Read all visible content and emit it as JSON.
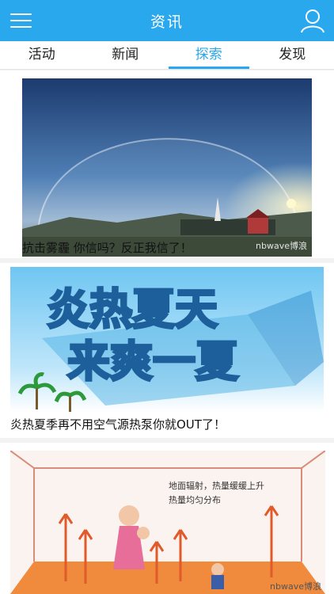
{
  "header": {
    "title": "资讯",
    "menu_icon": "menu-icon",
    "user_icon": "user-icon",
    "brand_color": "#2aa8ee"
  },
  "tabs": [
    {
      "label": "活动",
      "active": false
    },
    {
      "label": "新闻",
      "active": false
    },
    {
      "label": "探索",
      "active": true
    },
    {
      "label": "发现",
      "active": false
    }
  ],
  "articles": [
    {
      "caption": "抗击雾霾 你信吗？反正我信了！",
      "watermark": "nbwave博浪"
    },
    {
      "caption": "炎热夏季再不用空气源热泵你就OUT了！",
      "banner_line1": "炎热夏天",
      "banner_line2": "来爽一夏"
    },
    {
      "caption": "",
      "label_line1": "地面辐射，热量缓缓上升",
      "label_line2": "热量均匀分布",
      "watermark": "nbwave博浪"
    }
  ]
}
